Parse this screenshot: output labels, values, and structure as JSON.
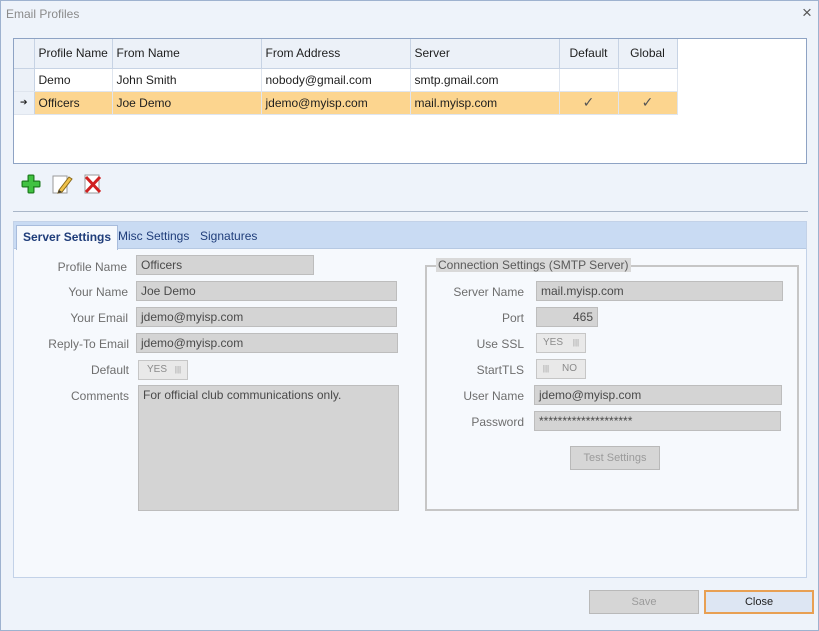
{
  "window": {
    "title": "Email Profiles",
    "close_glyph": "×"
  },
  "grid": {
    "columns": [
      "Profile Name",
      "From Name",
      "From Address",
      "Server",
      "Default",
      "Global"
    ],
    "rows": [
      {
        "indicator": "",
        "profile_name": "Demo",
        "from_name": "John Smith",
        "from_address": "nobody@gmail.com",
        "server": "smtp.gmail.com",
        "default": "",
        "global": ""
      },
      {
        "indicator": "➔",
        "profile_name": "Officers",
        "from_name": "Joe Demo",
        "from_address": "jdemo@myisp.com",
        "server": "mail.myisp.com",
        "default": "✓",
        "global": "✓"
      }
    ],
    "selected_row_color": "#fcd58f"
  },
  "toolbar": {
    "add_icon": "add-icon",
    "edit_icon": "edit-icon",
    "delete_icon": "delete-icon"
  },
  "tabs": [
    "Server Settings",
    "Misc Settings",
    "Signatures"
  ],
  "profile": {
    "profile_name_label": "Profile Name",
    "profile_name": "Officers",
    "your_name_label": "Your Name",
    "your_name": "Joe Demo",
    "your_email_label": "Your Email",
    "your_email": "jdemo@myisp.com",
    "reply_to_label": "Reply-To Email",
    "reply_to": "jdemo@myisp.com",
    "default_label": "Default",
    "default_value": "YES",
    "comments_label": "Comments",
    "comments": "For official club communications only."
  },
  "connection": {
    "group_title": "Connection Settings (SMTP Server)",
    "server_name_label": "Server Name",
    "server_name": "mail.myisp.com",
    "port_label": "Port",
    "port": "465",
    "use_ssl_label": "Use SSL",
    "use_ssl": "YES",
    "starttls_label": "StartTLS",
    "starttls": "NO",
    "user_name_label": "User Name",
    "user_name": "jdemo@myisp.com",
    "password_label": "Password",
    "password": "********************",
    "test_button": "Test Settings"
  },
  "footer": {
    "save_label": "Save",
    "close_label": "Close"
  }
}
